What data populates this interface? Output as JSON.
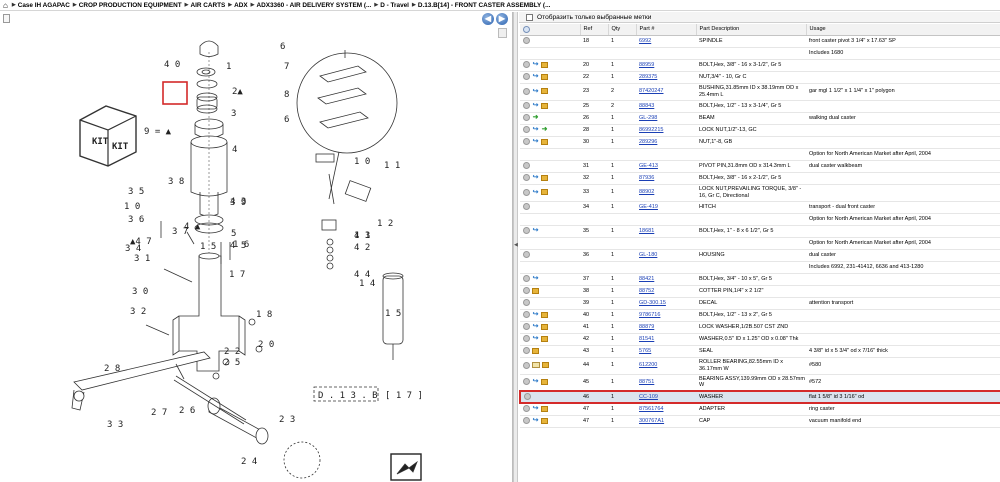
{
  "breadcrumb": [
    "Case IH AGAPAC",
    "CROP PRODUCTION EQUIPMENT",
    "AIR CARTS",
    "ADX",
    "ADX3360 - AIR DELIVERY SYSTEM (...",
    "D - Travel",
    "D.13.B[14] - FRONT CASTER ASSEMBLY (..."
  ],
  "left": {
    "nav_prev": "◀",
    "nav_next": "▶",
    "drawing_ref": "D . 1 3 . B",
    "drawing_ref2": "[ 1 7 ]",
    "kit_label": "KIT",
    "legend_9": "9 = ▲",
    "callouts": [
      "1",
      "2▲",
      "3",
      "4",
      "5",
      "6",
      "7",
      "8",
      "6",
      "1 0",
      "1 1",
      "1 2",
      "1 3",
      "1 4",
      "1 5",
      "1 6",
      "1 7",
      "1 8",
      "2 0",
      "2 2",
      "2 3",
      "2 4",
      "2 5",
      "2 6",
      "2 7",
      "2 8",
      "3 0",
      "3 1",
      "3 2",
      "3 3",
      "3 4",
      "3 5",
      "3 6",
      "3 7",
      "3 8",
      "3 9",
      "4 0",
      "4 1",
      "4 2",
      "4 3",
      "4 4",
      "4 5",
      "▲4 7",
      "1 0",
      "1 5",
      "4 ▲",
      "1 6"
    ]
  },
  "right": {
    "filter_label": "Отобразить только выбранные метки",
    "columns": [
      "Ref",
      "Qty",
      "Part #",
      "Part Description",
      "Usage"
    ],
    "rows": [
      {
        "icons": [
          "info"
        ],
        "ref": "18",
        "qty": "1",
        "part": "6992",
        "desc": "SPINDLE",
        "usage": "front caster pivot 3 1/4\" x 17.63\" SP",
        "h": 1
      },
      {
        "icons": [],
        "ref": "",
        "qty": "",
        "part": "",
        "desc": "",
        "usage": "Includes 1680",
        "h": 1
      },
      {
        "icons": [
          "info",
          "replace",
          "pkg"
        ],
        "ref": "20",
        "qty": "1",
        "part": "88959",
        "desc": "BOLT,Hex, 3/8\" - 16 x 3-1/2\", Gr 5",
        "usage": "",
        "h": 1
      },
      {
        "icons": [
          "info",
          "replace",
          "pkg"
        ],
        "ref": "22",
        "qty": "1",
        "part": "289375",
        "desc": "NUT,3/4\" - 10, Gr C",
        "usage": "",
        "h": 1
      },
      {
        "icons": [
          "info",
          "replace",
          "pkg"
        ],
        "ref": "23",
        "qty": "2",
        "part": "87420247",
        "desc": "BUSHING,31.85mm ID x 38.19mm OD x 25.4mm L",
        "usage": "gar mgl 1 1/2\" x 1 1/4\" x 1\" polygon",
        "h": 2
      },
      {
        "icons": [
          "info",
          "replace",
          "pkg"
        ],
        "ref": "25",
        "qty": "2",
        "part": "88843",
        "desc": "BOLT,Hex, 1/2\" - 13 x 3-1/4\", Gr 5",
        "usage": "",
        "h": 1
      },
      {
        "icons": [
          "info",
          "green"
        ],
        "ref": "26",
        "qty": "1",
        "part": "GL-298",
        "desc": "BEAM",
        "usage": "walking dual caster",
        "h": 1
      },
      {
        "icons": [
          "info",
          "replace",
          "green"
        ],
        "ref": "28",
        "qty": "1",
        "part": "86992215",
        "desc": "LOCK NUT,1/2\"-13, GC",
        "usage": "",
        "h": 1
      },
      {
        "icons": [
          "info",
          "replace",
          "pkg"
        ],
        "ref": "30",
        "qty": "1",
        "part": "289296",
        "desc": "NUT,1\"-8, GB",
        "usage": "",
        "h": 1
      },
      {
        "icons": [],
        "ref": "",
        "qty": "",
        "part": "",
        "desc": "",
        "usage": "Option for North American Market after April, 2004",
        "h": 1
      },
      {
        "icons": [
          "info"
        ],
        "ref": "31",
        "qty": "1",
        "part": "GE-413",
        "desc": "PIVOT PIN,31.8mm OD x 314.3mm L",
        "usage": "dual caster walkbeam",
        "h": 1
      },
      {
        "icons": [
          "info",
          "replace",
          "pkg"
        ],
        "ref": "32",
        "qty": "1",
        "part": "87936",
        "desc": "BOLT,Hex, 3/8\" - 16 x 2-1/2\", Gr 5",
        "usage": "",
        "h": 1
      },
      {
        "icons": [
          "info",
          "replace",
          "pkg"
        ],
        "ref": "33",
        "qty": "1",
        "part": "88902",
        "desc": "LOCK NUT,PREVAILING TORQUE, 3/8\" - 16, Gr C, Directional",
        "usage": "",
        "h": 2
      },
      {
        "icons": [
          "info"
        ],
        "ref": "34",
        "qty": "1",
        "part": "GE-419",
        "desc": "HITCH",
        "usage": "transport - dual front caster",
        "h": 1
      },
      {
        "icons": [],
        "ref": "",
        "qty": "",
        "part": "",
        "desc": "",
        "usage": "Option for North American Market after April, 2004",
        "h": 1
      },
      {
        "icons": [
          "info",
          "replace"
        ],
        "ref": "35",
        "qty": "1",
        "part": "18681",
        "desc": "BOLT,Hex, 1\" - 8 x 6 1/2\", Gr 5",
        "usage": "",
        "h": 1
      },
      {
        "icons": [],
        "ref": "",
        "qty": "",
        "part": "",
        "desc": "",
        "usage": "Option for North American Market after April, 2004",
        "h": 1
      },
      {
        "icons": [
          "info"
        ],
        "ref": "36",
        "qty": "1",
        "part": "GL-180",
        "desc": "HOUSING",
        "usage": "dual caster",
        "h": 1
      },
      {
        "icons": [],
        "ref": "",
        "qty": "",
        "part": "",
        "desc": "",
        "usage": "Includes 6992, 231-41412, 6636 and 413-1280",
        "h": 1
      },
      {
        "icons": [
          "info",
          "replace"
        ],
        "ref": "37",
        "qty": "1",
        "part": "88421",
        "desc": "BOLT,Hex, 3/4\" - 10 x 5\", Gr 5",
        "usage": "",
        "h": 1
      },
      {
        "icons": [
          "info",
          "pkg"
        ],
        "ref": "38",
        "qty": "1",
        "part": "88752",
        "desc": "COTTER PIN,1/4\" x 2 1/2\"",
        "usage": "",
        "h": 1
      },
      {
        "icons": [
          "info"
        ],
        "ref": "39",
        "qty": "1",
        "part": "GD-300.15",
        "desc": "DECAL",
        "usage": "attention transport",
        "h": 1
      },
      {
        "icons": [
          "info",
          "replace",
          "pkg"
        ],
        "ref": "40",
        "qty": "1",
        "part": "9786716",
        "desc": "BOLT,Hex, 1/2\" - 13 x 2\", Gr 5",
        "usage": "",
        "h": 1
      },
      {
        "icons": [
          "info",
          "replace",
          "pkg"
        ],
        "ref": "41",
        "qty": "1",
        "part": "88879",
        "desc": "LOCK WASHER,1/2B.507 CST ZND",
        "usage": "",
        "h": 1
      },
      {
        "icons": [
          "info",
          "replace",
          "pkg"
        ],
        "ref": "42",
        "qty": "1",
        "part": "81541",
        "desc": "WASHER,0.5\" ID x 1.25\" OD x 0.08\" Thk",
        "usage": "",
        "h": 1
      },
      {
        "icons": [
          "info",
          "pkg"
        ],
        "ref": "43",
        "qty": "1",
        "part": "5765",
        "desc": "SEAL",
        "usage": "4 3/8\" id x 5 3/4\" od x 7/16\" thick",
        "h": 1
      },
      {
        "icons": [
          "info",
          "mail",
          "pkg"
        ],
        "ref": "44",
        "qty": "1",
        "part": "612200",
        "desc": "ROLLER BEARING,82.55mm ID x 36.17mm W",
        "usage": "#580",
        "h": 2
      },
      {
        "icons": [
          "info",
          "replace",
          "pkg"
        ],
        "ref": "45",
        "qty": "1",
        "part": "88751",
        "desc": "BEARING ASSY,139.99mm OD x 28.57mm W",
        "usage": "#572",
        "h": 2
      },
      {
        "icons": [
          "info"
        ],
        "ref": "46",
        "qty": "1",
        "part": "CC-109",
        "desc": "WASHER",
        "usage": "flat 1 5/8\" id 3 1/16\" od",
        "h": 1,
        "selected": true
      },
      {
        "icons": [
          "info",
          "replace",
          "pkg"
        ],
        "ref": "47",
        "qty": "1",
        "part": "87561764",
        "desc": "ADAPTER",
        "usage": "ring caster",
        "h": 1
      },
      {
        "icons": [
          "info",
          "replace",
          "pkg"
        ],
        "ref": "47",
        "qty": "1",
        "part": "300767A1",
        "desc": "CAP",
        "usage": "vacuum manifold end",
        "h": 1
      }
    ]
  }
}
